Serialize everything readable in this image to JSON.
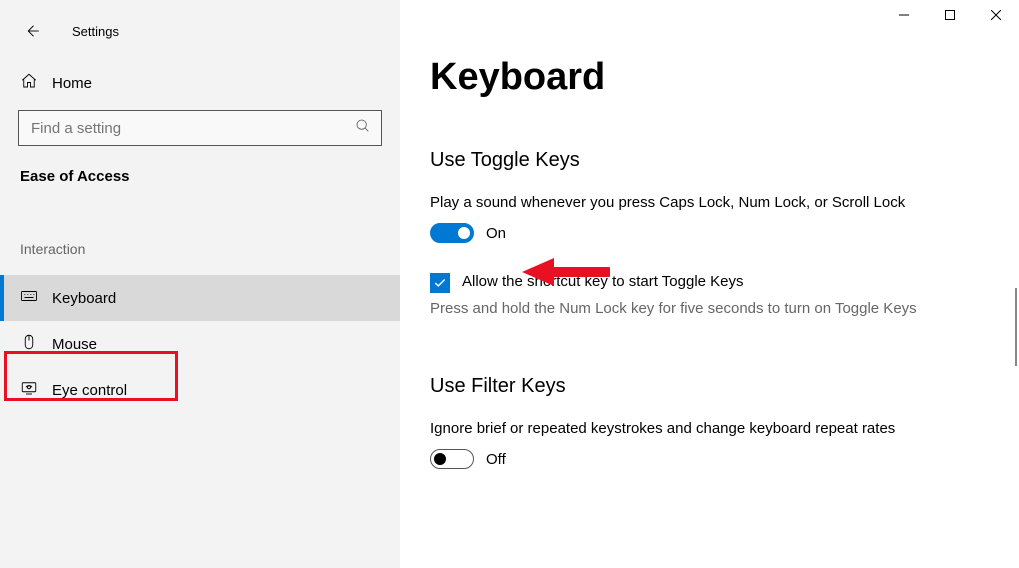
{
  "window": {
    "title": "Settings"
  },
  "sidebar": {
    "home_label": "Home",
    "search_placeholder": "Find a setting",
    "section_label": "Ease of Access",
    "group_label": "Interaction",
    "items": [
      {
        "label": "Keyboard",
        "active": true
      },
      {
        "label": "Mouse",
        "active": false
      },
      {
        "label": "Eye control",
        "active": false
      }
    ]
  },
  "main": {
    "title": "Keyboard",
    "toggle_keys": {
      "heading": "Use Toggle Keys",
      "description": "Play a sound whenever you press Caps Lock, Num Lock, or Scroll Lock",
      "toggle_state_label": "On",
      "toggle_on": true,
      "shortcut_checkbox_label": "Allow the shortcut key to start Toggle Keys",
      "shortcut_hint": "Press and hold the Num Lock key for five seconds to turn on Toggle Keys"
    },
    "filter_keys": {
      "heading": "Use Filter Keys",
      "description": "Ignore brief or repeated keystrokes and change keyboard repeat rates",
      "toggle_state_label": "Off",
      "toggle_on": false
    }
  },
  "annotations": {
    "highlight_color": "#e81123",
    "arrow_color": "#e81123"
  }
}
